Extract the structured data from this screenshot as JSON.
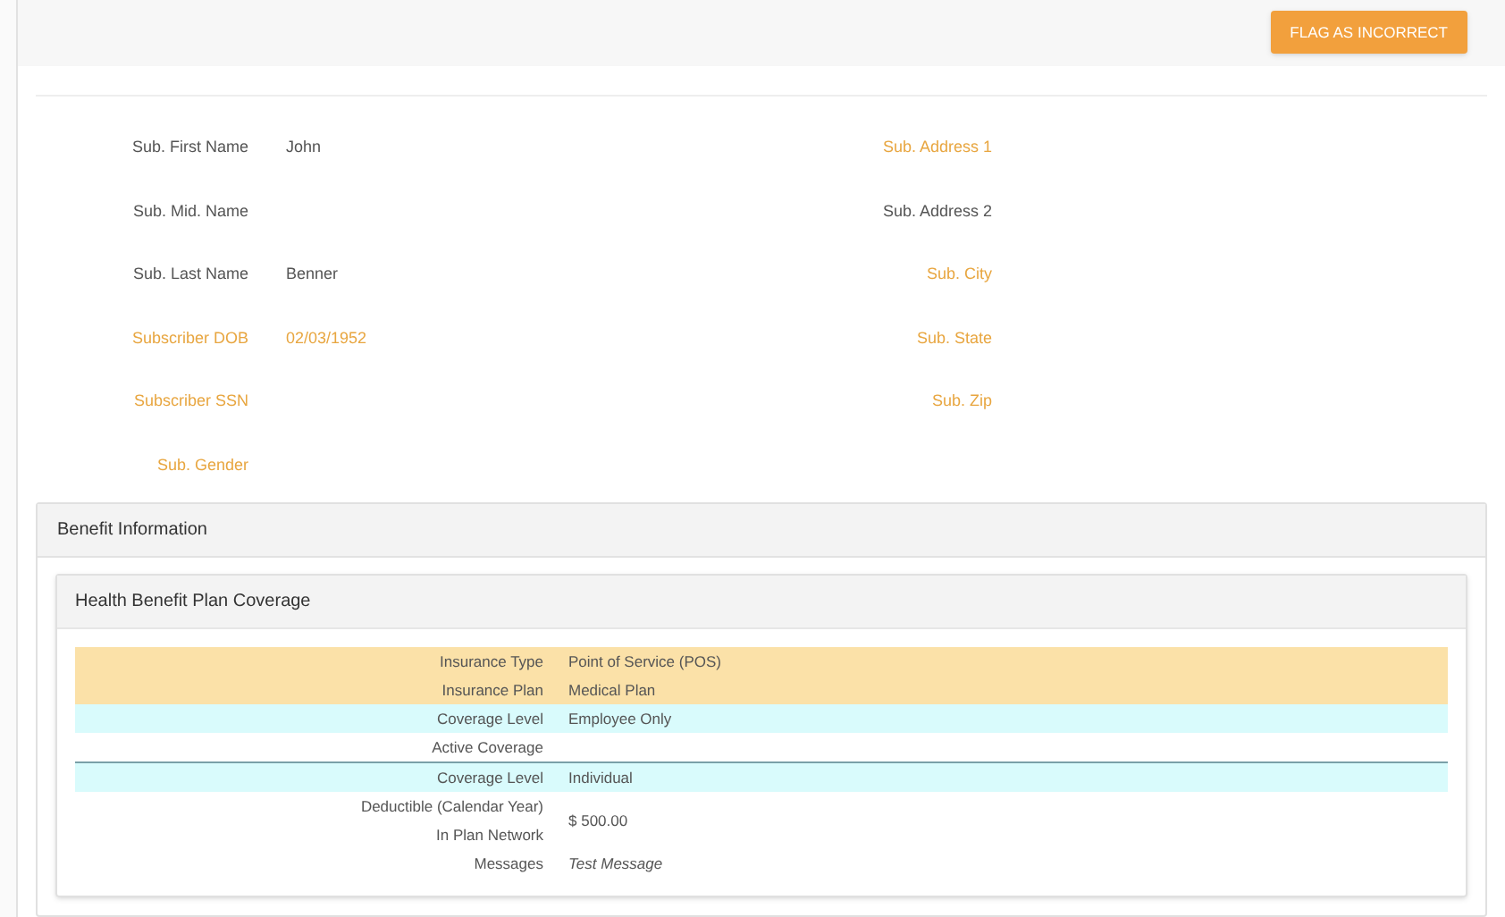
{
  "header": {
    "button": "FLAG AS INCORRECT"
  },
  "subscriber_fields": {
    "left": [
      {
        "label": "Sub. First Name",
        "value": "John",
        "flagged": false
      },
      {
        "label": "Sub. Mid. Name",
        "flagged": false
      },
      {
        "label": "Sub. Last Name",
        "value": "Benner",
        "flagged": false
      },
      {
        "label": "Subscriber DOB",
        "value": "02/03/1952",
        "flagged": true
      },
      {
        "label": "Subscriber SSN",
        "flagged": true
      },
      {
        "label": "Sub. Gender",
        "flagged": true
      }
    ],
    "right": [
      {
        "label": "Sub. Address 1",
        "flagged": true
      },
      {
        "label": "Sub. Address 2",
        "flagged": false
      },
      {
        "label": "Sub. City",
        "flagged": true
      },
      {
        "label": "Sub. State",
        "flagged": true
      },
      {
        "label": "Sub. Zip",
        "flagged": true
      }
    ]
  },
  "benefit_information": {
    "title": "Benefit Information",
    "plan_coverage": {
      "title": "Health Benefit Plan Coverage",
      "rows": [
        {
          "labels": [
            "Insurance Type",
            "Insurance Plan"
          ],
          "values": [
            "Point of Service (POS)",
            "Medical Plan"
          ],
          "color": "#fbe1a8",
          "divider_above": false,
          "kind": "plain"
        },
        {
          "labels": [
            "Coverage Level"
          ],
          "values": [
            "Employee Only"
          ],
          "color": "#d9fbfc",
          "divider_above": false,
          "kind": "plain"
        },
        {
          "labels": [
            "Active Coverage"
          ],
          "values": [],
          "color": "#ffffff",
          "divider_above": false,
          "kind": "plain"
        },
        {
          "labels": [
            "Coverage Level"
          ],
          "values": [
            "Individual"
          ],
          "color": "#d9fbfc",
          "divider_above": true,
          "kind": "plain"
        },
        {
          "labels": [
            "Deductible (Calendar Year)",
            "In Plan Network"
          ],
          "values": [
            "$ 500.00"
          ],
          "color": "#ffffff",
          "divider_above": false,
          "kind": "plain"
        },
        {
          "labels": [
            "Messages"
          ],
          "values": [
            "Test Message"
          ],
          "color": "#ffffff",
          "divider_above": false,
          "kind": "message"
        }
      ]
    }
  }
}
